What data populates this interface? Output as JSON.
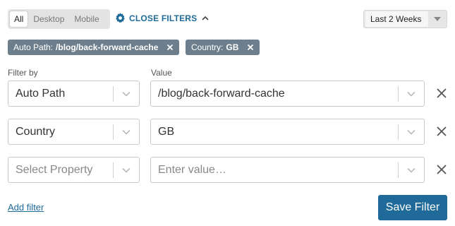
{
  "device_filter": {
    "options": [
      {
        "label": "All",
        "active": true
      },
      {
        "label": "Desktop",
        "active": false
      },
      {
        "label": "Mobile",
        "active": false
      }
    ]
  },
  "toggle": {
    "label": "CLOSE FILTERS",
    "icon": "gear-icon",
    "chevron": "chevron-up-icon",
    "color": "#1f6a99"
  },
  "date_range": {
    "selected": "Last 2 Weeks"
  },
  "active_chips": [
    {
      "key": "Auto Path:",
      "value": "/blog/back-forward-cache"
    },
    {
      "key": "Country:",
      "value": "GB"
    }
  ],
  "columns": {
    "filter_by": "Filter by",
    "value": "Value"
  },
  "rows": [
    {
      "property": "Auto Path",
      "value": "/blog/back-forward-cache",
      "property_placeholder": false,
      "value_placeholder": false
    },
    {
      "property": "Country",
      "value": "GB",
      "property_placeholder": false,
      "value_placeholder": false
    },
    {
      "property": "Select Property",
      "value": "Enter value…",
      "property_placeholder": true,
      "value_placeholder": true
    }
  ],
  "actions": {
    "add_filter": "Add filter",
    "save": "Save Filter"
  },
  "colors": {
    "accent": "#1f6a99",
    "chip_bg": "#6d7f8c"
  }
}
